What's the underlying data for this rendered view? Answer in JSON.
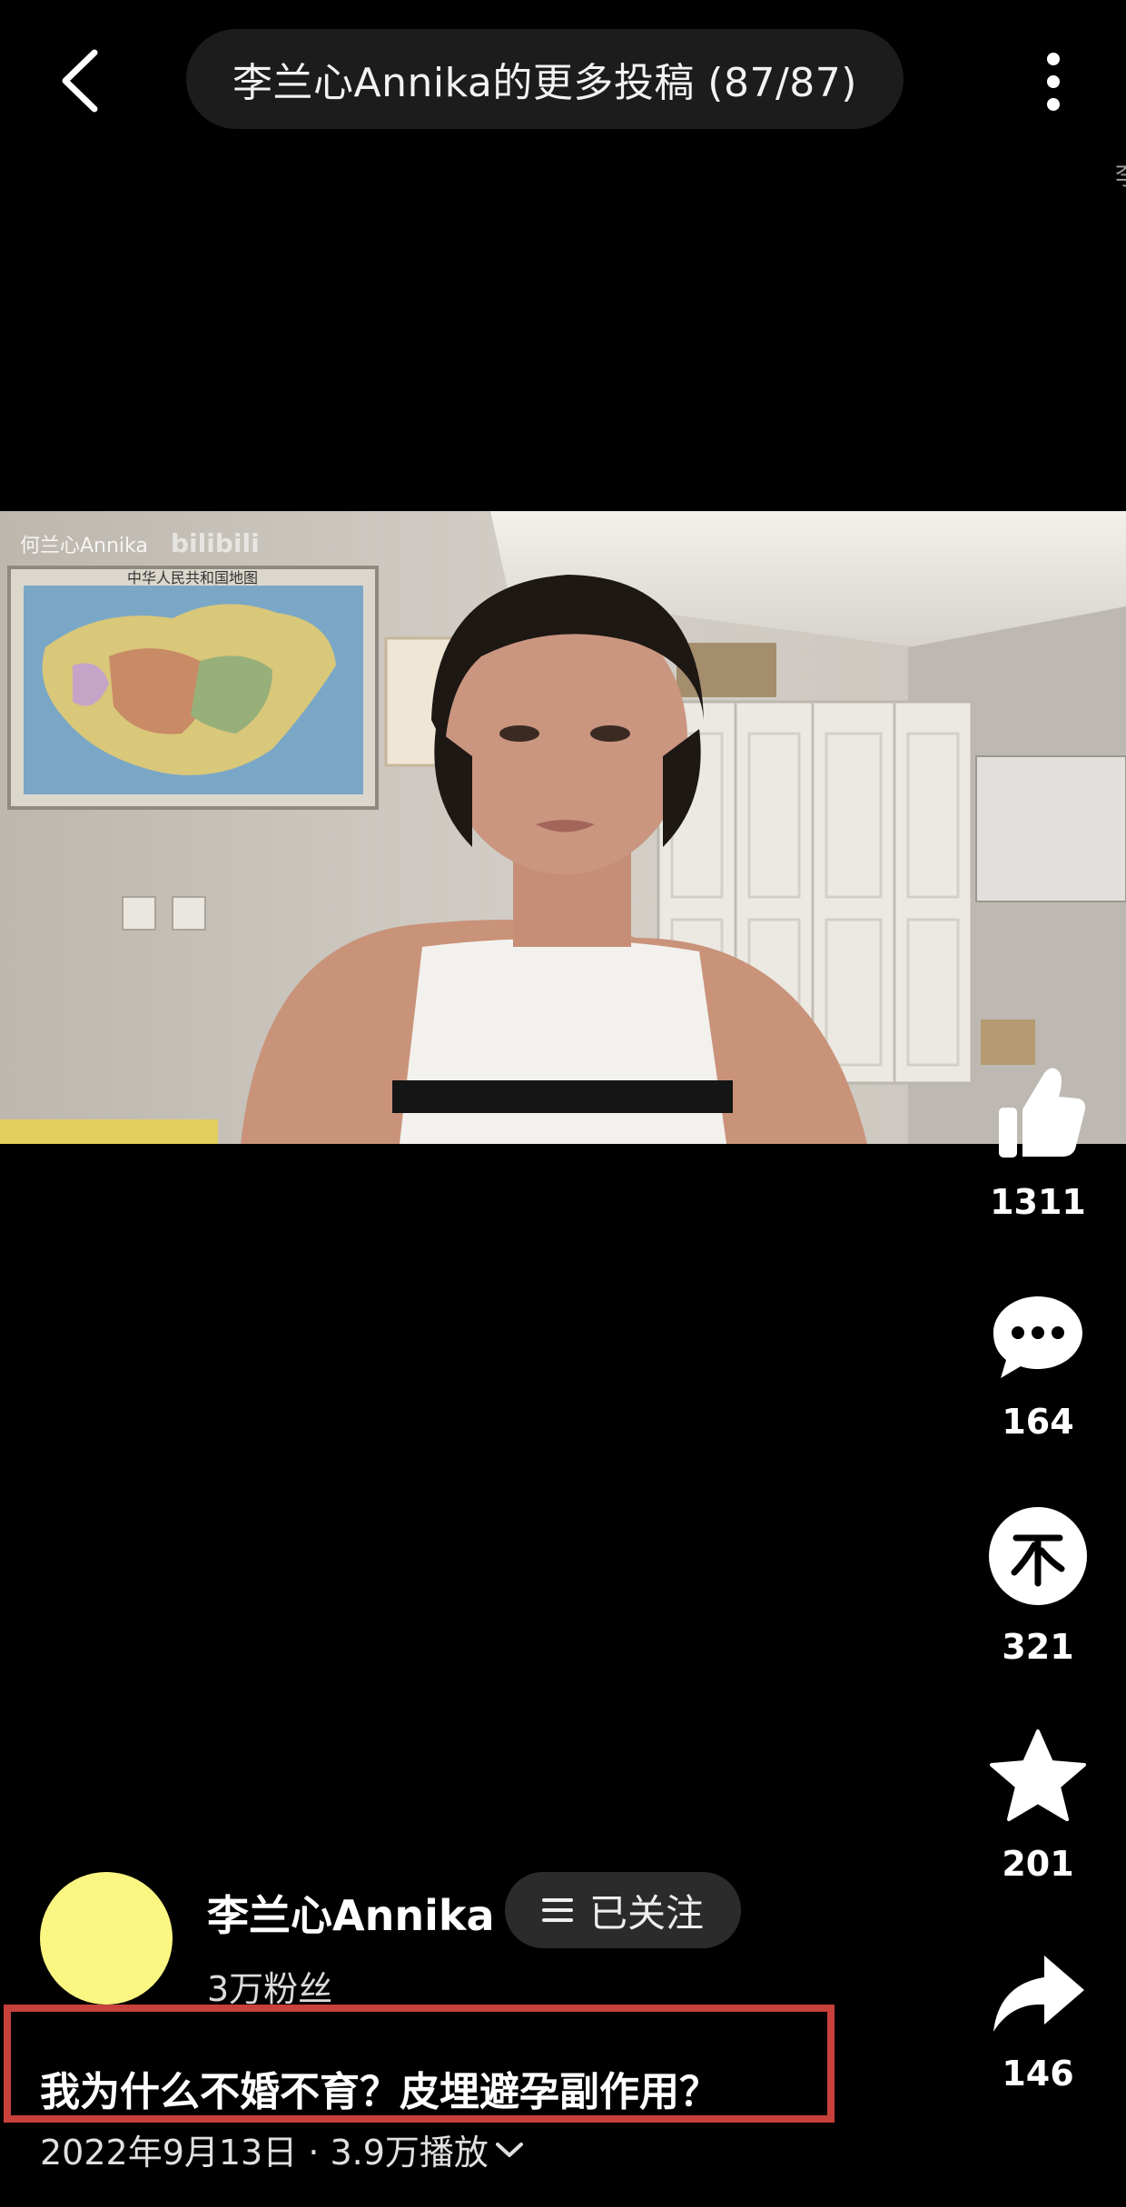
{
  "header": {
    "title": "李兰心Annika的更多投稿 (87/87)",
    "back_icon": "chevron-left-icon",
    "more_icon": "vertical-dots-icon",
    "edge_glyph": "李"
  },
  "video": {
    "watermark": "何兰心Annika",
    "watermark_brand": "bilibili",
    "map_caption": "中华人民共和国地图"
  },
  "actions": {
    "like_count": "1311",
    "comment_count": "164",
    "coin_count": "321",
    "favorite_count": "201",
    "share_count": "146"
  },
  "author": {
    "name": "李兰心Annika",
    "follow_label": "已关注",
    "fans": "3万粉丝",
    "avatar_color": "#fbf682"
  },
  "info": {
    "title": "我为什么不婚不育？皮埋避孕副作用？",
    "meta": "2022年9月13日 · 3.9万播放"
  },
  "colors": {
    "background": "#000000",
    "highlight": "#c8413b"
  }
}
